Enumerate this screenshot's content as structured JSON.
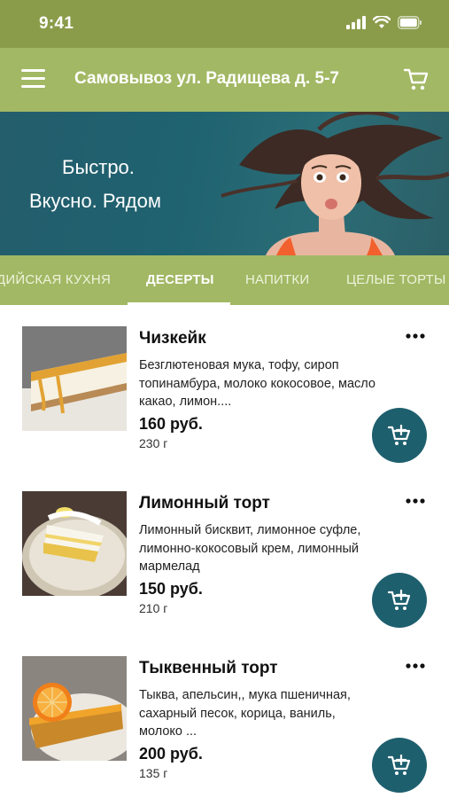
{
  "status": {
    "time": "9:41"
  },
  "header": {
    "title": "Самовывоз ул. Радищева д. 5-7"
  },
  "banner": {
    "line1": "Быстро.",
    "line2": "Вкусно. Рядом"
  },
  "tabs": [
    {
      "label": "ДИЙСКАЯ КУХНЯ"
    },
    {
      "label": "ДЕСЕРТЫ"
    },
    {
      "label": "НАПИТКИ"
    },
    {
      "label": "ЦЕЛЫЕ ТОРТЫ"
    }
  ],
  "active_tab": "ДЕСЕРТЫ",
  "products": [
    {
      "name": "Чизкейк",
      "description": "Безглютеновая мука, тофу, сироп топинамбура, молоко кокосовое, масло какао, лимон....",
      "price": "160 руб.",
      "weight": "230 г"
    },
    {
      "name": "Лимонный торт",
      "description": "Лимонный бисквит, лимонное суфле, лимонно-кокосовый крем, лимонный мармелад",
      "price": "150 руб.",
      "weight": "210 г"
    },
    {
      "name": "Тыквенный торт",
      "description": "Тыква, апельсин,, мука пшеничная, сахарный песок, корица, ваниль, молоко ...",
      "price": "200 руб.",
      "weight": "135 г"
    }
  ],
  "colors": {
    "status_bar": "#8a9c4a",
    "app_bar": "#a2b864",
    "banner": "#245d6c",
    "cart_button": "#1e5f6e"
  },
  "icons": {
    "menu": "hamburger-icon",
    "cart": "cart-icon",
    "more": "more-dots-icon",
    "add_to_cart": "cart-plus-icon"
  }
}
